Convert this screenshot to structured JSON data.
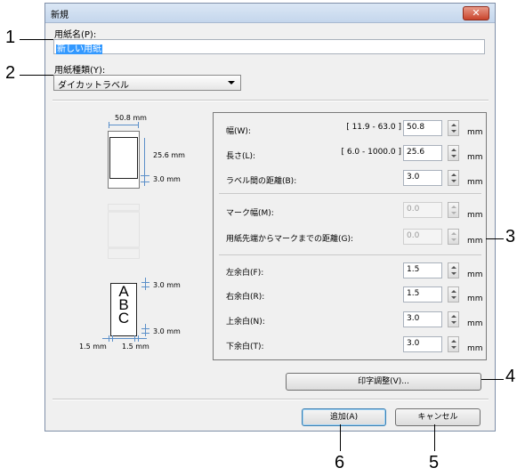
{
  "window": {
    "title": "新規",
    "close_label": "✕"
  },
  "paper_name": {
    "label": "用紙名(P):",
    "value": "新しい用紙"
  },
  "paper_type": {
    "label": "用紙種類(Y):",
    "value": "ダイカットラベル"
  },
  "preview": {
    "width_label": "50.8 mm",
    "length_label": "25.6 mm",
    "gap_label": "3.0 mm",
    "top_margin_label": "3.0 mm",
    "bottom_margin_label": "3.0 mm",
    "left_margin_label": "1.5 mm",
    "right_margin_label": "1.5 mm",
    "sample_text": [
      "A",
      "B",
      "C"
    ]
  },
  "settings": {
    "width": {
      "label": "幅(W):",
      "range": "[ 11.9 - 63.0 ]",
      "value": "50.8",
      "unit": "mm"
    },
    "length": {
      "label": "長さ(L):",
      "range": "[ 6.0 - 1000.0 ]",
      "value": "25.6",
      "unit": "mm"
    },
    "label_gap": {
      "label": "ラベル間の距離(B):",
      "value": "3.0",
      "unit": "mm"
    },
    "mark_width": {
      "label": "マーク幅(M):",
      "value": "0.0",
      "unit": "mm"
    },
    "mark_distance": {
      "label": "用紙先端からマークまでの距離(G):",
      "value": "0.0",
      "unit": "mm"
    },
    "left_margin": {
      "label": "左余白(F):",
      "value": "1.5",
      "unit": "mm"
    },
    "right_margin": {
      "label": "右余白(R):",
      "value": "1.5",
      "unit": "mm"
    },
    "top_margin": {
      "label": "上余白(N):",
      "value": "3.0",
      "unit": "mm"
    },
    "bottom_margin": {
      "label": "下余白(T):",
      "value": "3.0",
      "unit": "mm"
    }
  },
  "buttons": {
    "print_adjust": "印字調整(V)...",
    "add": "追加(A)",
    "cancel": "キャンセル"
  },
  "callouts": {
    "c1": "1",
    "c2": "2",
    "c3": "3",
    "c4": "4",
    "c5": "5",
    "c6": "6"
  }
}
